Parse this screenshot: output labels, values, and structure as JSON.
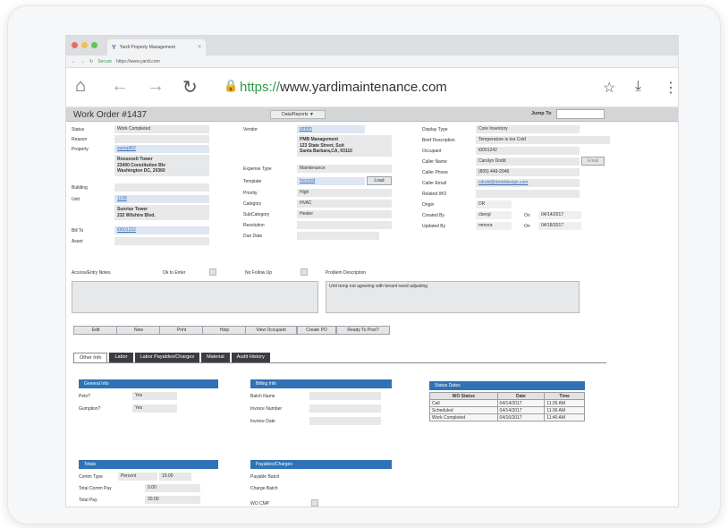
{
  "browser": {
    "tab_title": "Yardi Property Management",
    "tab_close": "×",
    "address_small_secure": "Secure",
    "address_small_url": "https://www.yardi.com",
    "url_scheme": "https://",
    "url_host": "www.yardimaintenance.com"
  },
  "colors": {
    "accent": "#2f73b6",
    "dark_tab": "#3b3d40",
    "secure_green": "#2e9a4a"
  },
  "icons": {
    "home": "⌂",
    "back": "←",
    "forward": "→",
    "reload": "↻",
    "lock": "🔒",
    "bookmark": "☆",
    "download": "⤓",
    "menu": "⋮"
  },
  "header": {
    "title": "Work Order #1437",
    "dropdown": "Data/Reports ▼",
    "jump_to": "Jump To"
  },
  "left": {
    "status_label": "Status",
    "status_value": "Work Completed",
    "reason_label": "Reason",
    "property_label": "Property",
    "property_value": "sumrpf02",
    "property_addr": [
      "Roosevelt Tower",
      "23400 Constitution Blv",
      "Washington DC, 20360"
    ],
    "building_label": "Building",
    "unit_label": "Unit",
    "unit_value": "1108",
    "unit_addr": [
      "Sunrise Tower",
      "232 Wilshire Blvd."
    ],
    "billto_label": "Bill To",
    "billto_value": "t0001232",
    "asset_label": "Asset"
  },
  "middle": {
    "vendor_label": "Vendor",
    "vendor_value": "pmbm",
    "vendor_addr": [
      "PMB Management",
      "123 State Street, Suit",
      "Santa Barbara,CA, 93110"
    ],
    "expense_label": "Expense Type",
    "expense_value": "Maintenance",
    "template_label": "Template",
    "template_value": "hvcnoid",
    "load_button": "Load",
    "priority_label": "Priority",
    "priority_value": "High",
    "category_label": "Category",
    "category_value": "HVAC",
    "subcategory_label": "SubCategory",
    "subcategory_value": "Heater",
    "resolution_label": "Resolution",
    "duedate_label": "Due Date"
  },
  "right": {
    "display_type_label": "Display Type",
    "display_type_value": "Core Inventory",
    "brief_label": "Brief Description",
    "brief_value": "Temperature is too Cold",
    "occupant_label": "Occupant",
    "occupant_value": "t0001242",
    "caller_name_label": "Caller Name",
    "caller_name_value": "Carolyn Dodd",
    "email_button": "Email",
    "caller_phone_label": "Caller Phone",
    "caller_phone_value": "(805) 449-2048",
    "caller_email_label": "Caller Email",
    "caller_email_value": "cdodd@dodddesign.com",
    "related_label": "Related WO",
    "origin_label": "Origin",
    "origin_value": "DR",
    "created_label": "Created By",
    "created_value": "cbergi",
    "on1": "On",
    "created_date": "04/14/2017",
    "updated_label": "Updated By",
    "updated_value": "mmora",
    "on2": "On",
    "updated_date": "04/18/2017"
  },
  "notes": {
    "access_label": "Access/Entry Notes",
    "ok_label": "Ok to Enter",
    "nofollow_label": "No Follow Up",
    "problem_label": "Problem Description",
    "problem_text": "Unit temp not agreeing with tenant need adjusting"
  },
  "actions": [
    "Edit",
    "New",
    "Print",
    "Help",
    "View Occupant",
    "Create PO",
    "Ready To Post?"
  ],
  "tabs": [
    "Other Info",
    "Labor",
    "Labor Payables/Charges",
    "Material",
    "Audit History"
  ],
  "general_info": {
    "title": "General Info",
    "pets_label": "Pets?",
    "pets_value": "Yes",
    "gumption_label": "Gumption?",
    "gumption_value": "Yes"
  },
  "billing_info": {
    "title": "Billing Info",
    "batch_label": "Batch Name",
    "invoice_number_label": "Invoice Number",
    "invoice_date_label": "Invoice Date"
  },
  "status_dates": {
    "title": "Status Dates",
    "headers": [
      "WO Status",
      "Date",
      "Time"
    ],
    "rows": [
      [
        "Call",
        "04/14/2017",
        "11:26 AM"
      ],
      [
        "Scheduled",
        "04/14/2017",
        "11:36 AM"
      ],
      [
        "Work Completed",
        "04/16/2017",
        "11:40 AM"
      ]
    ]
  },
  "totals": {
    "title": "Totals",
    "comm_type_label": "Comm Type",
    "comm_type_value": "Percent",
    "comm_value": "10.00",
    "total_comm_label": "Total Comm Pay",
    "total_comm_value": "0.00",
    "total_pay_label": "Total Pay",
    "total_pay_value": "20.00"
  },
  "payables": {
    "title": "Payables/Charges",
    "batch_label": "Payable Batch",
    "charge_label": "Charge Batch",
    "wocmp_label": "WO CMP"
  }
}
